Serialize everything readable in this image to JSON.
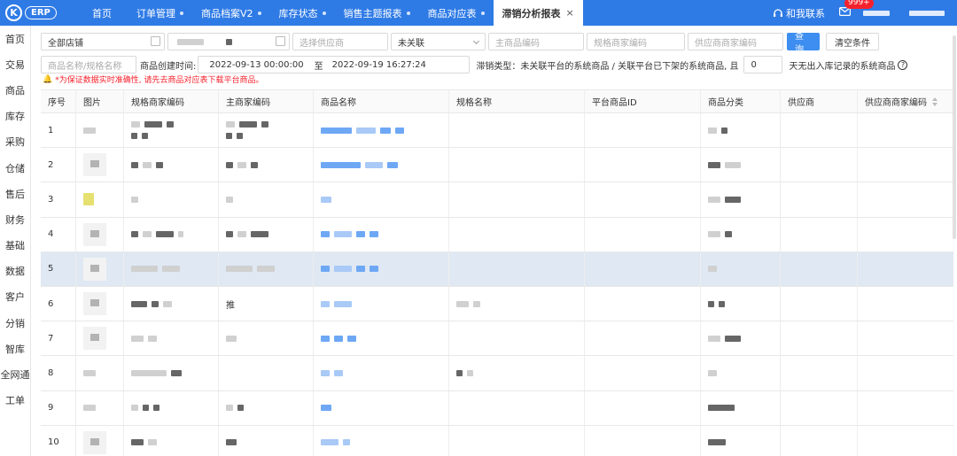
{
  "logo": {
    "letter": "K",
    "text": "ERP"
  },
  "nav": {
    "home": "首页",
    "tabs": [
      {
        "label": "订单管理"
      },
      {
        "label": "商品档案V2"
      },
      {
        "label": "库存状态"
      },
      {
        "label": "销售主题报表"
      },
      {
        "label": "商品对应表"
      }
    ],
    "active_tab": {
      "label": "滞销分析报表",
      "close": "×"
    }
  },
  "top_right": {
    "contact": "和我联系",
    "badge": "999+"
  },
  "sidebar": [
    "首页",
    "交易",
    "商品",
    "库存",
    "采购",
    "仓储",
    "售后",
    "财务",
    "基础",
    "数据",
    "客户",
    "分销",
    "智库",
    "全网通",
    "工单"
  ],
  "filters": {
    "shop": "全部店铺",
    "supplier_placeholder": "选择供应商",
    "association": "未关联",
    "main_code_placeholder": "主商品编码",
    "spec_code_placeholder": "规格商家编码",
    "supplier_code_placeholder": "供应商商家编码",
    "query_btn": "查询",
    "clear_btn": "清空条件",
    "name_placeholder": "商品名称/规格名称",
    "created_label": "商品创建时间:",
    "date_from": "2022-09-13 00:00:00",
    "date_sep": "至",
    "date_to": "2022-09-19 16:27:24",
    "type_label": "滞销类型：未关联平台的系统商品 / 关联平台已下架的系统商品, 且",
    "days_value": "0",
    "days_suffix": "天无出入库记录的系统商品",
    "help": "?"
  },
  "warning": "*为保证数据实时准确性, 请先去商品对应表下载平台商品。",
  "table": {
    "headers": [
      "序号",
      "图片",
      "规格商家编码",
      "主商家编码",
      "商品名称",
      "规格名称",
      "平台商品ID",
      "商品分类",
      "供应商",
      "供应商商家编码"
    ],
    "rows": [
      {
        "no": "1",
        "main_text": ""
      },
      {
        "no": "2",
        "main_text": ""
      },
      {
        "no": "3",
        "main_text": ""
      },
      {
        "no": "4",
        "main_text": ""
      },
      {
        "no": "5",
        "main_text": ""
      },
      {
        "no": "6",
        "main_text": "推"
      },
      {
        "no": "7",
        "main_text": ""
      },
      {
        "no": "8",
        "main_text": ""
      },
      {
        "no": "9",
        "main_text": ""
      },
      {
        "no": "10",
        "main_text": ""
      }
    ],
    "highlight_row": 5
  },
  "colors": {
    "primary": "#2f7be6",
    "button": "#3d8ef0",
    "warning": "#f5222d",
    "row_highlight": "#dfe8f3"
  }
}
